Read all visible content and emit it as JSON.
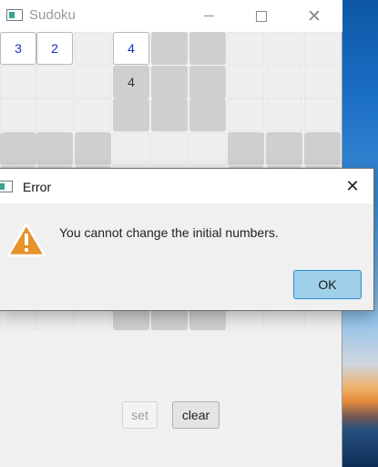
{
  "sudoku_window": {
    "title": "Sudoku",
    "board": [
      [
        "3",
        "2",
        "",
        "4",
        "",
        "",
        "",
        "",
        ""
      ],
      [
        "",
        "",
        "",
        "4",
        "",
        "",
        "",
        "",
        ""
      ],
      [
        "",
        "",
        "",
        "",
        "",
        "",
        "",
        "",
        ""
      ],
      [
        "",
        "",
        "",
        "",
        "",
        "",
        "",
        "",
        ""
      ],
      [
        "",
        "",
        "",
        "",
        "",
        "",
        "",
        "",
        ""
      ],
      [
        "",
        "",
        "",
        "",
        "",
        "",
        "",
        "",
        ""
      ],
      [
        "",
        "",
        "",
        "",
        "",
        "",
        "",
        "",
        ""
      ],
      [
        "",
        "",
        "",
        "",
        "",
        "",
        "",
        "",
        ""
      ],
      [
        "",
        "",
        "",
        "",
        "",
        "",
        "",
        "",
        ""
      ]
    ],
    "set_label": "set",
    "clear_label": "clear"
  },
  "error_dialog": {
    "title": "Error",
    "message": "You cannot change the initial numbers.",
    "ok_label": "OK"
  },
  "colors": {
    "user_digit": "#1c2fc4",
    "given_digit": "#333333",
    "ok_button_fill": "#9fd0ea",
    "ok_button_border": "#2c8ccd",
    "warning_fill": "#e5932a"
  },
  "icons": {
    "app": "app-window-icon",
    "warning": "warning-triangle-icon",
    "close": "close-icon"
  }
}
